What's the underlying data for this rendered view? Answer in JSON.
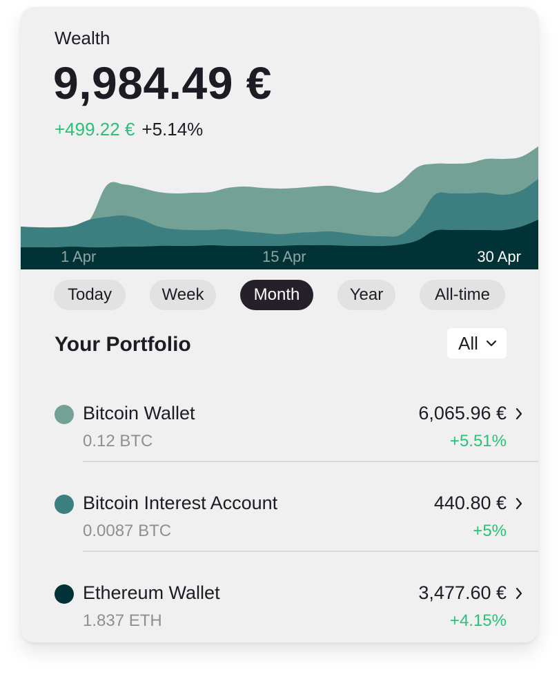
{
  "header": {
    "label": "Wealth",
    "total": "9,984.49 €",
    "change_abs": "+499.22 €",
    "change_pct": "+5.14%"
  },
  "chart_data": {
    "type": "area",
    "stacked": true,
    "x_labels": [
      "1 Apr",
      "15 Apr",
      "30 Apr"
    ],
    "active_label": "30 Apr",
    "colors": [
      "#013336",
      "#3d7f80",
      "#73a195"
    ],
    "series": [
      {
        "name": "Ethereum Wallet",
        "color": "#013336",
        "values": [
          32,
          32,
          32,
          33,
          32,
          32,
          33,
          33,
          34,
          34,
          34,
          35,
          34,
          34,
          34,
          34,
          35,
          35,
          35,
          34,
          34,
          34,
          36,
          42,
          56,
          57,
          57,
          57,
          57,
          62,
          72
        ]
      },
      {
        "name": "Bitcoin Interest Account",
        "color": "#3d7f80",
        "values": [
          62,
          61,
          61,
          63,
          72,
          76,
          78,
          72,
          62,
          58,
          57,
          57,
          58,
          55,
          53,
          51,
          53,
          54,
          55,
          52,
          49,
          48,
          50,
          72,
          108,
          110,
          110,
          111,
          108,
          114,
          131
        ]
      },
      {
        "name": "Bitcoin Wallet",
        "color": "#73a195",
        "values": [
          62,
          60,
          59,
          62,
          72,
          122,
          123,
          118,
          112,
          110,
          111,
          112,
          118,
          120,
          118,
          117,
          118,
          120,
          121,
          117,
          113,
          112,
          126,
          148,
          153,
          153,
          154,
          160,
          160,
          163,
          178
        ]
      }
    ],
    "ylim": [
      0,
      180
    ]
  },
  "periods": {
    "active": "Month",
    "items": [
      "Today",
      "Week",
      "Month",
      "Year",
      "All-time"
    ]
  },
  "portfolio": {
    "title": "Your Portfolio",
    "filter_label": "All",
    "assets": [
      {
        "name": "Bitcoin Wallet",
        "amount": "0.12 BTC",
        "value": "6,065.96 €",
        "change": "+5.51%",
        "color": "#73a195"
      },
      {
        "name": "Bitcoin Interest Account",
        "amount": "0.0087 BTC",
        "value": "440.80 €",
        "change": "+5%",
        "color": "#3d7f80"
      },
      {
        "name": "Ethereum Wallet",
        "amount": "1.837 ETH",
        "value": "3,477.60 €",
        "change": "+4.15%",
        "color": "#013336"
      }
    ]
  },
  "icons": {
    "filter_chevron": "chevron-down-icon",
    "row_chevron": "chevron-right-icon"
  }
}
